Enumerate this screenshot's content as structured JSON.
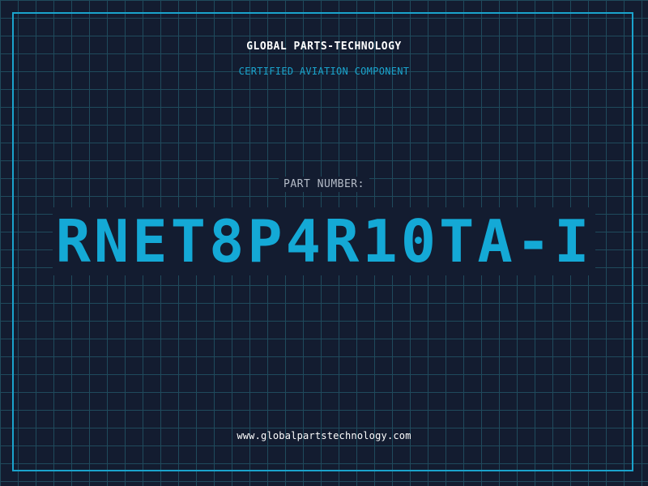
{
  "header": {
    "company_name": "GLOBAL PARTS-TECHNOLOGY",
    "tagline": "CERTIFIED AVIATION COMPONENT"
  },
  "part": {
    "label": "PART NUMBER:",
    "number": "RNET8P4R10TA-I"
  },
  "footer": {
    "website": "www.globalpartstechnology.com"
  },
  "colors": {
    "background": "#131c30",
    "grid": "#1f4a5c",
    "accent": "#1aa3cc",
    "part_number": "#14a9d6",
    "text_primary": "#ffffff",
    "text_label": "#b5bcc8"
  }
}
